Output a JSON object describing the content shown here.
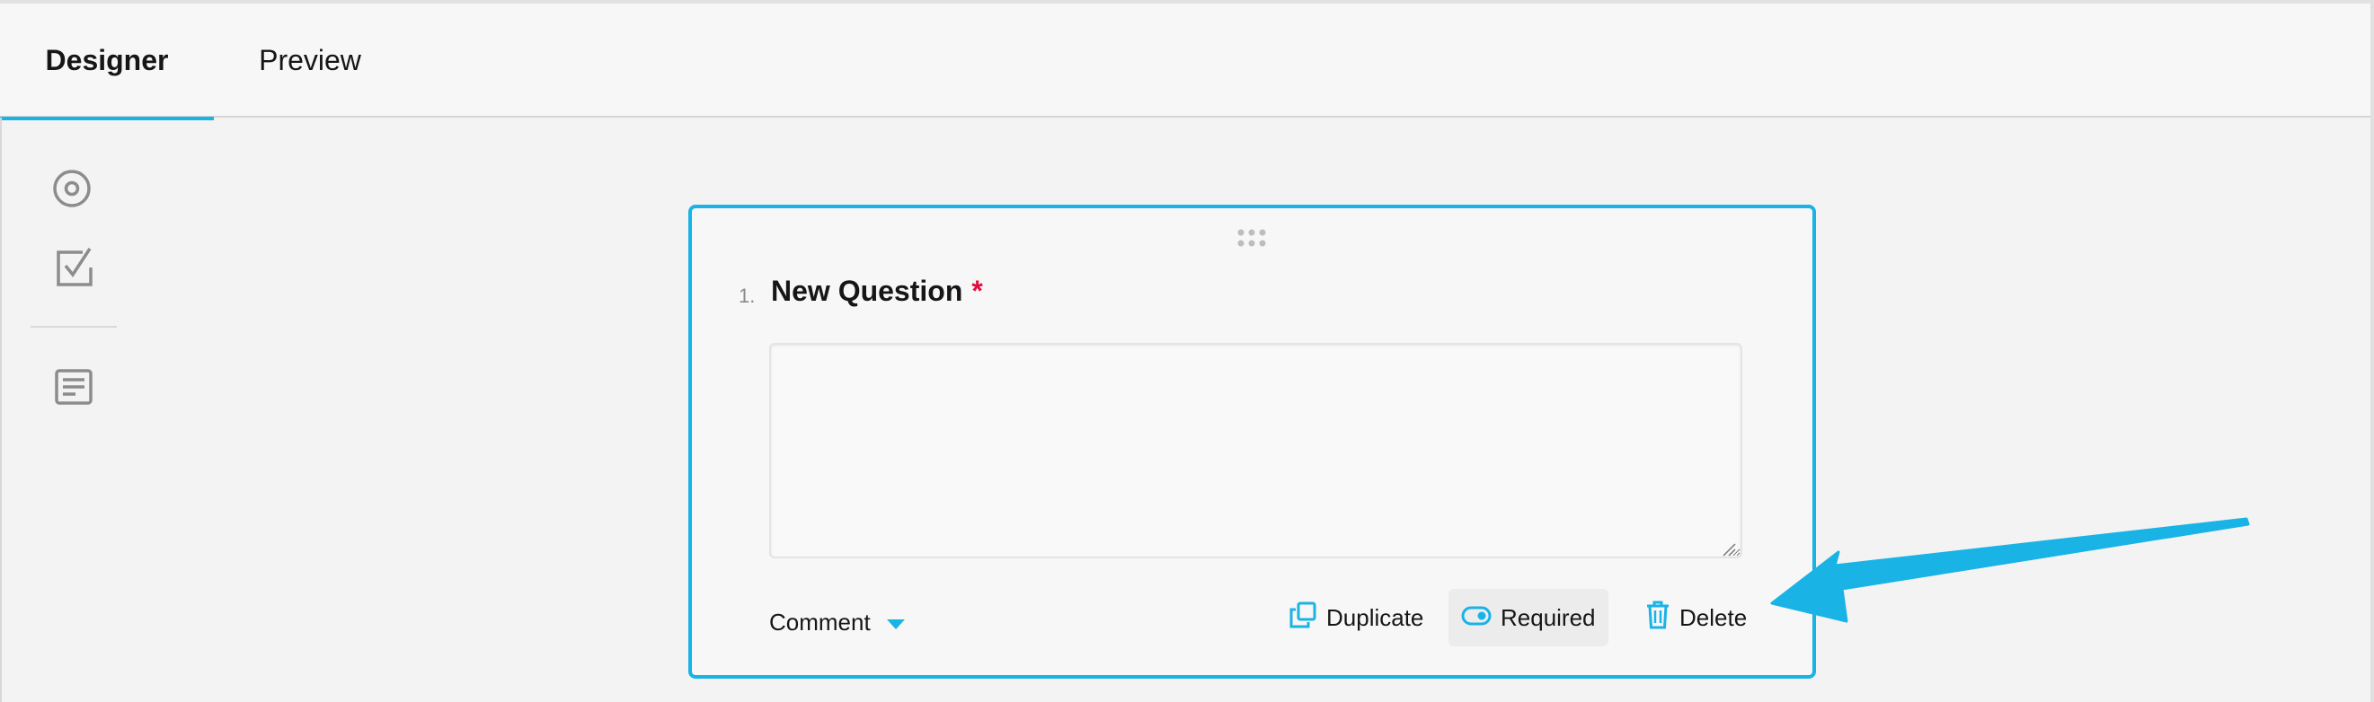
{
  "tabs": [
    {
      "label": "Designer",
      "active": true
    },
    {
      "label": "Preview",
      "active": false
    }
  ],
  "toolbox": {
    "items": [
      {
        "icon": "radio-group-icon"
      },
      {
        "icon": "checkbox-icon"
      },
      {
        "icon": "comment-icon"
      }
    ]
  },
  "question": {
    "number": "1.",
    "title": "New Question",
    "required_mark": "*",
    "comment_value": "",
    "type_label": "Comment",
    "actions": {
      "duplicate": "Duplicate",
      "required": "Required",
      "delete": "Delete"
    }
  },
  "colors": {
    "accent": "#19b3e6",
    "required": "#e60a3e",
    "background": "#f3f3f3"
  }
}
